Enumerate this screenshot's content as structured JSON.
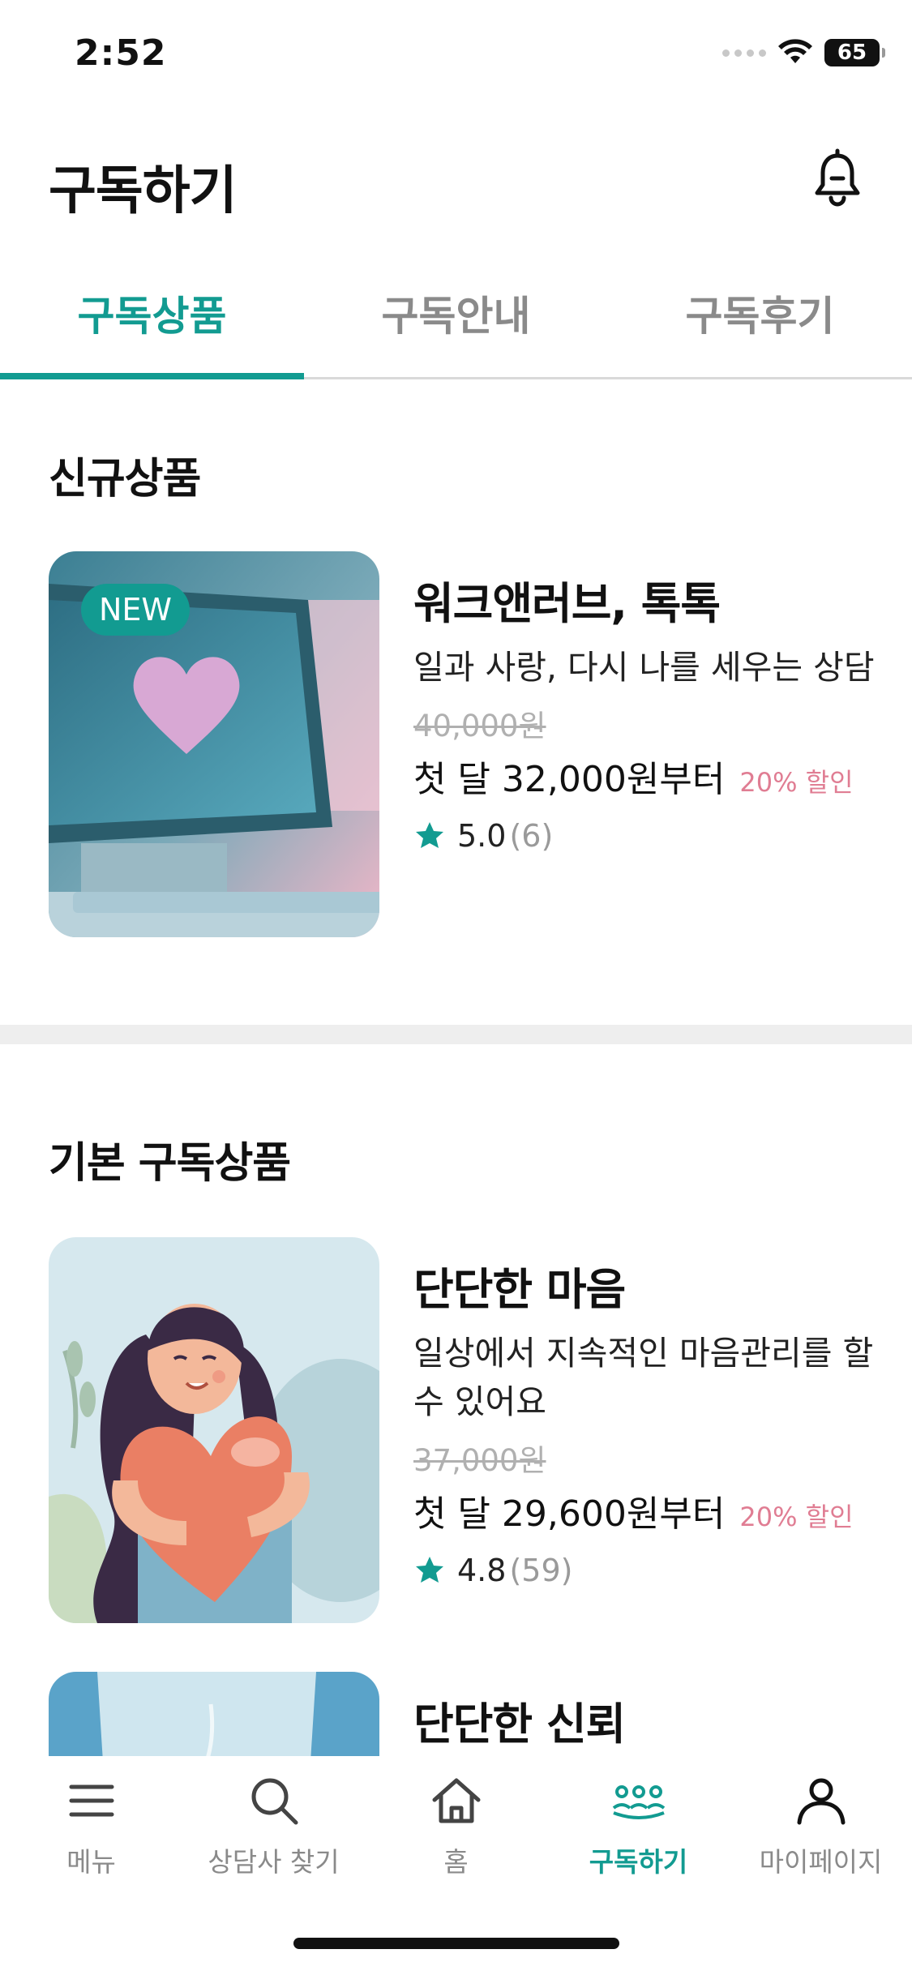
{
  "status_bar": {
    "time": "2:52",
    "battery": "65"
  },
  "header": {
    "title": "구독하기"
  },
  "tabs": [
    {
      "label": "구독상품",
      "active": true
    },
    {
      "label": "구독안내",
      "active": false
    },
    {
      "label": "구독후기",
      "active": false
    }
  ],
  "sections": {
    "new": {
      "title": "신규상품",
      "card": {
        "badge": "NEW",
        "title": "워크앤러브, 톡톡",
        "description": "일과 사랑, 다시 나를 세우는 상담",
        "original_price": "40,000원",
        "price": "첫 달 32,000원부터",
        "discount": "20% 할인",
        "rating": "5.0",
        "review_count": "(6)"
      }
    },
    "basic": {
      "title": "기본 구독상품",
      "cards": [
        {
          "title": "단단한 마음",
          "description": "일상에서 지속적인 마음관리를 할 수 있어요",
          "original_price": "37,000원",
          "price": "첫 달 29,600원부터",
          "discount": "20% 할인",
          "rating": "4.8",
          "review_count": "(59)"
        },
        {
          "title": "단단한 신뢰"
        }
      ]
    }
  },
  "bottom_nav": [
    {
      "label": "메뉴",
      "icon": "menu-icon",
      "active": false
    },
    {
      "label": "상담사 찾기",
      "icon": "search-icon",
      "active": false
    },
    {
      "label": "홈",
      "icon": "home-icon",
      "active": false
    },
    {
      "label": "구독하기",
      "icon": "subscribe-people-icon",
      "active": true
    },
    {
      "label": "마이페이지",
      "icon": "person-icon",
      "active": false
    }
  ],
  "colors": {
    "accent": "#129b91",
    "discount": "#e07d93",
    "muted": "#8a8a8a"
  }
}
